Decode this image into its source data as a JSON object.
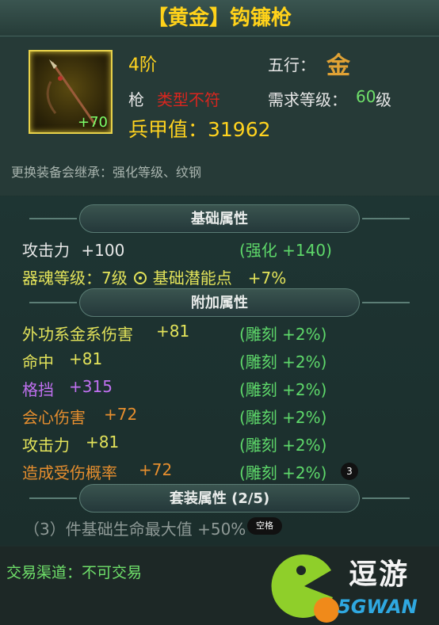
{
  "item": {
    "title": "【黄金】钩镰枪",
    "enhance_level": "+70",
    "grade": "4阶",
    "wuxing_label": "五行：",
    "wuxing_value": "金",
    "weapon_type": "枪",
    "type_warning": "类型不符",
    "req_label": "需求等级：",
    "req_level": "60",
    "req_unit": "级",
    "power": "兵甲值：31962",
    "inherit_note": "更换装备会继承：强化等级、纹钢"
  },
  "base_attrs": {
    "header": "基础属性",
    "attack_label": "攻击力",
    "attack_value": "+100",
    "attack_bonus": "(强化 +140)",
    "soul_text": "器魂等级：7级",
    "potential_text": "基础潜能点　+7%"
  },
  "extra_attrs": {
    "header": "附加属性",
    "rows": [
      {
        "label": "外功系金系伤害",
        "value": "+81",
        "bonus": "(雕刻 +2%)"
      },
      {
        "label": "命中",
        "value": "+81",
        "bonus": "(雕刻 +2%)"
      },
      {
        "label": "格挡",
        "value": "+315",
        "bonus": "(雕刻 +2%)"
      },
      {
        "label": "会心伤害",
        "value": "+72",
        "bonus": "(雕刻 +2%)"
      },
      {
        "label": "攻击力",
        "value": "+81",
        "bonus": "(雕刻 +2%)"
      },
      {
        "label": "造成受伤概率",
        "value": "+72",
        "bonus": "(雕刻 +2%)"
      }
    ]
  },
  "set_attrs": {
    "header": "套装属性 (2/5)",
    "line": "（3）件基础生命最大值 +50%"
  },
  "overlays": {
    "badge_number": "3",
    "badge_space": "空格"
  },
  "trade": "交易渠道：不可交易",
  "watermark": {
    "brand": "逗游",
    "domain": "5GWAN"
  },
  "colors": {
    "gold": "#ffd21a",
    "warning": "#d8261f",
    "green": "#6fe06a",
    "purple": "#c070f0",
    "orange": "#e68e2e"
  }
}
